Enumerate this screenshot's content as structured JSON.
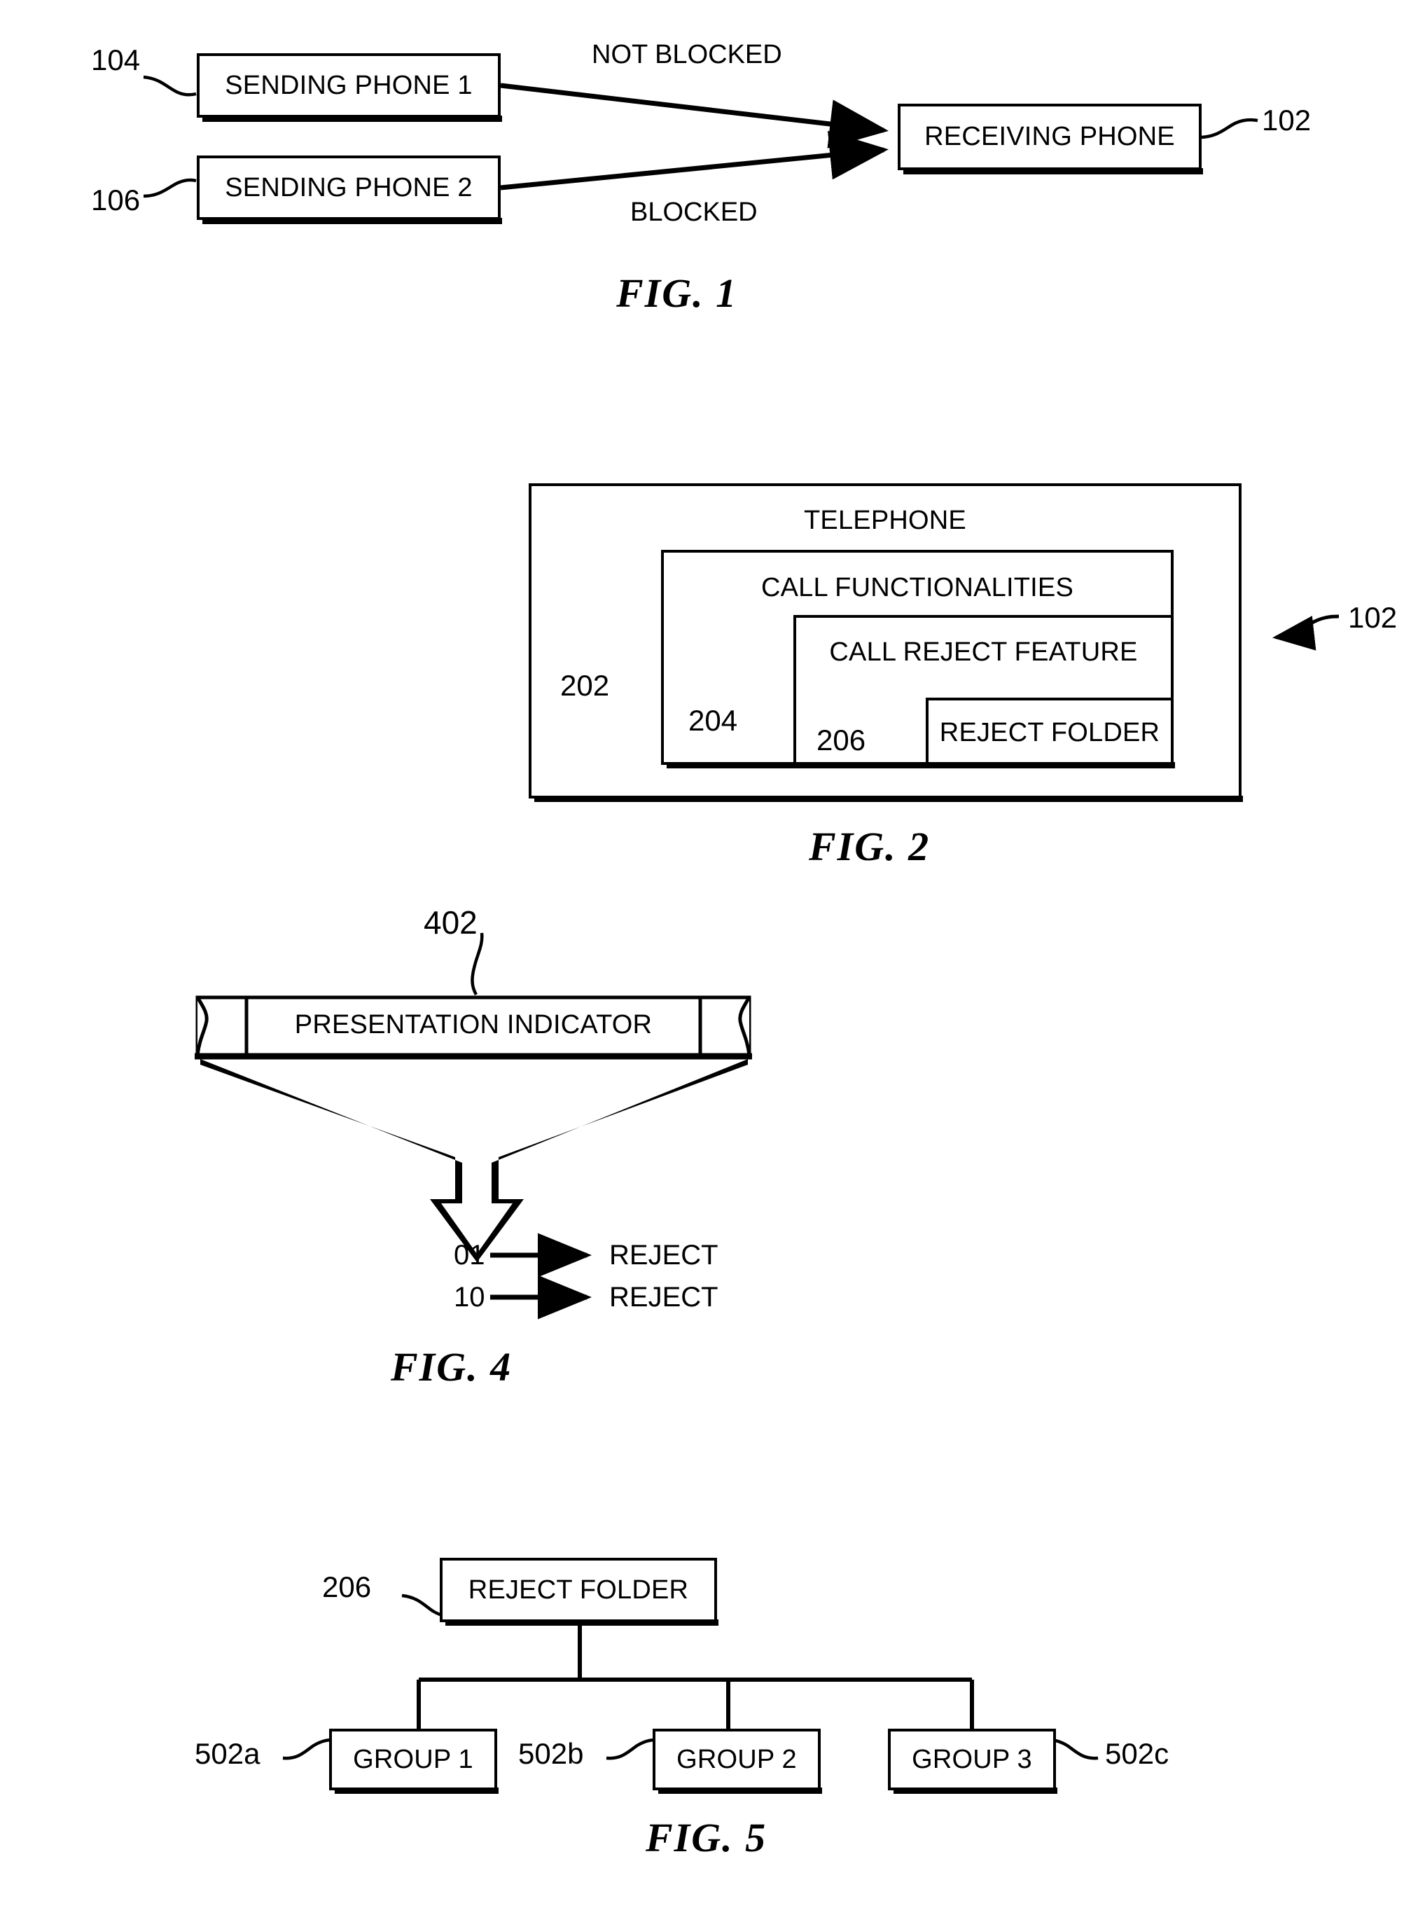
{
  "document": {
    "type": "patent-figure-sheet",
    "figures": [
      "FIG. 1",
      "FIG. 2",
      "FIG. 4",
      "FIG. 5"
    ]
  },
  "fig1": {
    "caption": "FIG. 1",
    "boxes": {
      "sending_phone_1": "SENDING PHONE 1",
      "sending_phone_2": "SENDING PHONE 2",
      "receiving_phone": "RECEIVING PHONE"
    },
    "refs": {
      "sending_phone_1": "104",
      "sending_phone_2": "106",
      "receiving_phone": "102"
    },
    "edges": {
      "top": "NOT BLOCKED",
      "bottom": "BLOCKED"
    }
  },
  "fig2": {
    "caption": "FIG. 2",
    "boxes": {
      "telephone": "TELEPHONE",
      "call_functionalities": "CALL FUNCTIONALITIES",
      "call_reject_feature": "CALL REJECT FEATURE",
      "reject_folder": "REJECT FOLDER"
    },
    "refs": {
      "telephone": "202",
      "call_functionalities": "204",
      "call_reject_feature": "206",
      "device": "102"
    }
  },
  "fig4": {
    "caption": "FIG. 4",
    "banner_label": "PRESENTATION INDICATOR",
    "ref": "402",
    "mappings": [
      {
        "code": "01",
        "result": "REJECT"
      },
      {
        "code": "10",
        "result": "REJECT"
      }
    ]
  },
  "fig5": {
    "caption": "FIG. 5",
    "root": {
      "label": "REJECT FOLDER",
      "ref": "206"
    },
    "children": [
      {
        "label": "GROUP 1",
        "ref": "502a"
      },
      {
        "label": "GROUP 2",
        "ref": "502b"
      },
      {
        "label": "GROUP 3",
        "ref": "502c"
      }
    ]
  },
  "colors": {
    "ink": "#000000",
    "paper": "#ffffff"
  }
}
